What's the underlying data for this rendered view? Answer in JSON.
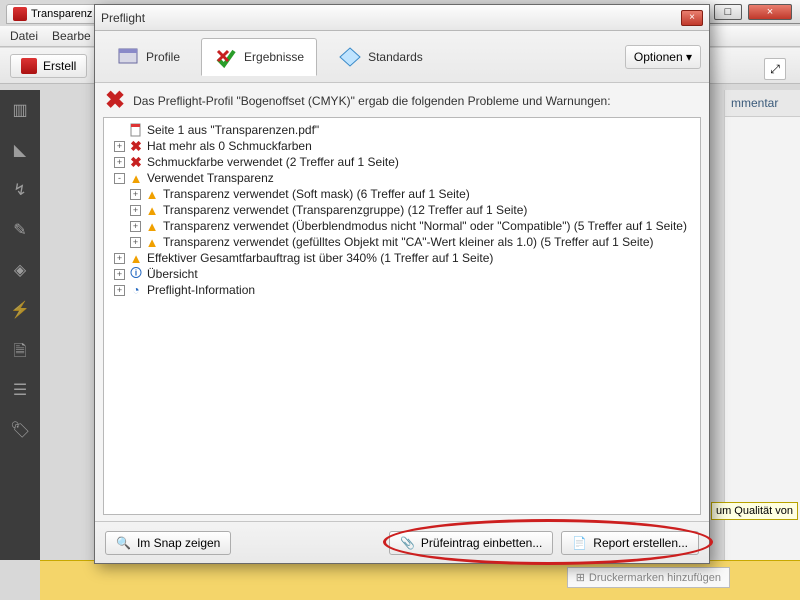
{
  "parent": {
    "tab_label": "Transparenz",
    "menu": [
      "Datei",
      "Bearbe"
    ],
    "toolbar_create": "Erstell",
    "right_header": "mmentar",
    "right_tip": "um Qualität von",
    "footer_item": "Druckermarken hinzufügen"
  },
  "outer_window_buttons": {
    "min": "–",
    "max": "□",
    "close": "×"
  },
  "dialog": {
    "title": "Preflight",
    "close": "×",
    "tabs": [
      {
        "id": "profile",
        "label": "Profile",
        "icon": "profile-icon"
      },
      {
        "id": "results",
        "label": "Ergebnisse",
        "icon": "results-icon",
        "active": true
      },
      {
        "id": "standards",
        "label": "Standards",
        "icon": "standards-icon"
      }
    ],
    "options_label": "Optionen",
    "summary": "Das Preflight-Profil \"Bogenoffset (CMYK)\" ergab die folgenden Probleme und Warnungen:",
    "tree": [
      {
        "depth": 0,
        "expander": "",
        "icon": "page",
        "label": "Seite 1 aus \"Transparenzen.pdf\""
      },
      {
        "depth": 0,
        "expander": "+",
        "icon": "redx",
        "label": "Hat mehr als 0 Schmuckfarben"
      },
      {
        "depth": 0,
        "expander": "+",
        "icon": "redx",
        "label": "Schmuckfarbe verwendet (2 Treffer auf 1 Seite)"
      },
      {
        "depth": 0,
        "expander": "-",
        "icon": "warn",
        "label": "Verwendet Transparenz"
      },
      {
        "depth": 1,
        "expander": "+",
        "icon": "warn",
        "label": "Transparenz verwendet (Soft mask) (6 Treffer auf 1 Seite)"
      },
      {
        "depth": 1,
        "expander": "+",
        "icon": "warn",
        "label": "Transparenz verwendet (Transparenzgruppe) (12 Treffer auf 1 Seite)"
      },
      {
        "depth": 1,
        "expander": "+",
        "icon": "warn",
        "label": "Transparenz verwendet (Überblendmodus nicht \"Normal\" oder \"Compatible\") (5 Treffer auf 1 Seite)"
      },
      {
        "depth": 1,
        "expander": "+",
        "icon": "warn",
        "label": "Transparenz verwendet (gefülltes Objekt mit \"CA\"-Wert kleiner als 1.0) (5 Treffer auf 1 Seite)"
      },
      {
        "depth": 0,
        "expander": "+",
        "icon": "warn",
        "label": "Effektiver Gesamtfarbauftrag ist über 340% (1 Treffer auf 1 Seite)"
      },
      {
        "depth": 0,
        "expander": "+",
        "icon": "info1",
        "label": "Übersicht"
      },
      {
        "depth": 0,
        "expander": "+",
        "icon": "info2",
        "label": "Preflight-Information"
      }
    ],
    "footer": {
      "snap": "Im Snap zeigen",
      "embed": "Prüfeintrag einbetten...",
      "report": "Report erstellen..."
    }
  }
}
